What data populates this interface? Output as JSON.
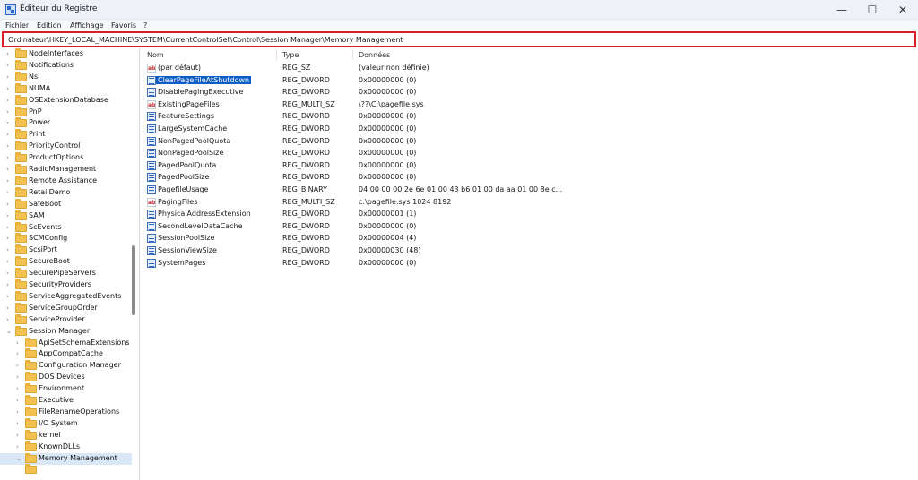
{
  "window": {
    "title": "Éditeur du Registre",
    "controls": [
      "minimize-icon",
      "maximize-icon",
      "close-icon"
    ]
  },
  "menubar": {
    "items": [
      {
        "label": "Fichier"
      },
      {
        "label": "Edition"
      },
      {
        "label": "Affichage"
      },
      {
        "label": "Favoris"
      },
      {
        "label": "?"
      }
    ]
  },
  "address": {
    "path": "Ordinateur\\HKEY_LOCAL_MACHINE\\SYSTEM\\CurrentControlSet\\Control\\Session Manager\\Memory Management",
    "highlight_color": "#d61f26"
  },
  "tree": {
    "items": [
      {
        "label": "NodeInterfaces",
        "level": 1,
        "expanded": false
      },
      {
        "label": "Notifications",
        "level": 1,
        "expanded": false
      },
      {
        "label": "Nsi",
        "level": 1,
        "expanded": false
      },
      {
        "label": "NUMA",
        "level": 1,
        "expanded": false
      },
      {
        "label": "OSExtensionDatabase",
        "level": 1,
        "expanded": false
      },
      {
        "label": "PnP",
        "level": 1,
        "expanded": false
      },
      {
        "label": "Power",
        "level": 1,
        "expanded": false
      },
      {
        "label": "Print",
        "level": 1,
        "expanded": false
      },
      {
        "label": "PriorityControl",
        "level": 1,
        "expanded": false
      },
      {
        "label": "ProductOptions",
        "level": 1,
        "expanded": false
      },
      {
        "label": "RadioManagement",
        "level": 1,
        "expanded": false
      },
      {
        "label": "Remote Assistance",
        "level": 1,
        "expanded": false
      },
      {
        "label": "RetailDemo",
        "level": 1,
        "expanded": false
      },
      {
        "label": "SafeBoot",
        "level": 1,
        "expanded": false
      },
      {
        "label": "SAM",
        "level": 1,
        "expanded": false
      },
      {
        "label": "ScEvents",
        "level": 1,
        "expanded": false
      },
      {
        "label": "SCMConfig",
        "level": 1,
        "expanded": false
      },
      {
        "label": "ScsiPort",
        "level": 1,
        "expanded": false
      },
      {
        "label": "SecureBoot",
        "level": 1,
        "expanded": false
      },
      {
        "label": "SecurePipeServers",
        "level": 1,
        "expanded": false
      },
      {
        "label": "SecurityProviders",
        "level": 1,
        "expanded": false
      },
      {
        "label": "ServiceAggregatedEvents",
        "level": 1,
        "expanded": false
      },
      {
        "label": "ServiceGroupOrder",
        "level": 1,
        "expanded": false
      },
      {
        "label": "ServiceProvider",
        "level": 1,
        "expanded": false
      },
      {
        "label": "Session Manager",
        "level": 1,
        "expanded": true
      },
      {
        "label": "ApiSetSchemaExtensions",
        "level": 2,
        "expanded": false
      },
      {
        "label": "AppCompatCache",
        "level": 2,
        "expanded": false
      },
      {
        "label": "Configuration Manager",
        "level": 2,
        "expanded": false
      },
      {
        "label": "DOS Devices",
        "level": 2,
        "expanded": false
      },
      {
        "label": "Environment",
        "level": 2,
        "expanded": false
      },
      {
        "label": "Executive",
        "level": 2,
        "expanded": false
      },
      {
        "label": "FileRenameOperations",
        "level": 2,
        "expanded": false
      },
      {
        "label": "I/O System",
        "level": 2,
        "expanded": false
      },
      {
        "label": "kernel",
        "level": 2,
        "expanded": false
      },
      {
        "label": "KnownDLLs",
        "level": 2,
        "expanded": false
      },
      {
        "label": "Memory Management",
        "level": 2,
        "expanded": true,
        "selected": true
      }
    ]
  },
  "table": {
    "columns": [
      "Nom",
      "Type",
      "Données"
    ],
    "rows": [
      {
        "icon": "string-value-icon",
        "name": "(par défaut)",
        "type": "REG_SZ",
        "data": "(valeur non définie)"
      },
      {
        "icon": "binary-value-icon",
        "name": "ClearPageFileAtShutdown",
        "type": "REG_DWORD",
        "data": "0x00000000 (0)",
        "selected": true
      },
      {
        "icon": "binary-value-icon",
        "name": "DisablePagingExecutive",
        "type": "REG_DWORD",
        "data": "0x00000000 (0)"
      },
      {
        "icon": "string-value-icon",
        "name": "ExistingPageFiles",
        "type": "REG_MULTI_SZ",
        "data": "\\??\\C:\\pagefile.sys"
      },
      {
        "icon": "binary-value-icon",
        "name": "FeatureSettings",
        "type": "REG_DWORD",
        "data": "0x00000000 (0)"
      },
      {
        "icon": "binary-value-icon",
        "name": "LargeSystemCache",
        "type": "REG_DWORD",
        "data": "0x00000000 (0)"
      },
      {
        "icon": "binary-value-icon",
        "name": "NonPagedPoolQuota",
        "type": "REG_DWORD",
        "data": "0x00000000 (0)"
      },
      {
        "icon": "binary-value-icon",
        "name": "NonPagedPoolSize",
        "type": "REG_DWORD",
        "data": "0x00000000 (0)"
      },
      {
        "icon": "binary-value-icon",
        "name": "PagedPoolQuota",
        "type": "REG_DWORD",
        "data": "0x00000000 (0)"
      },
      {
        "icon": "binary-value-icon",
        "name": "PagedPoolSize",
        "type": "REG_DWORD",
        "data": "0x00000000 (0)"
      },
      {
        "icon": "binary-value-icon",
        "name": "PagefileUsage",
        "type": "REG_BINARY",
        "data": "04 00 00 00 2e 6e 01 00 43 b6 01 00 da aa 01 00 8e c..."
      },
      {
        "icon": "string-value-icon",
        "name": "PagingFiles",
        "type": "REG_MULTI_SZ",
        "data": "c:\\pagefile.sys 1024 8192"
      },
      {
        "icon": "binary-value-icon",
        "name": "PhysicalAddressExtension",
        "type": "REG_DWORD",
        "data": "0x00000001 (1)"
      },
      {
        "icon": "binary-value-icon",
        "name": "SecondLevelDataCache",
        "type": "REG_DWORD",
        "data": "0x00000000 (0)"
      },
      {
        "icon": "binary-value-icon",
        "name": "SessionPoolSize",
        "type": "REG_DWORD",
        "data": "0x00000004 (4)"
      },
      {
        "icon": "binary-value-icon",
        "name": "SessionViewSize",
        "type": "REG_DWORD",
        "data": "0x00000030 (48)"
      },
      {
        "icon": "binary-value-icon",
        "name": "SystemPages",
        "type": "REG_DWORD",
        "data": "0x00000000 (0)"
      }
    ]
  },
  "colors": {
    "selection": "#0b5cc7",
    "folder": "#f2c14f",
    "tree_selected": "#d9e7f7"
  }
}
